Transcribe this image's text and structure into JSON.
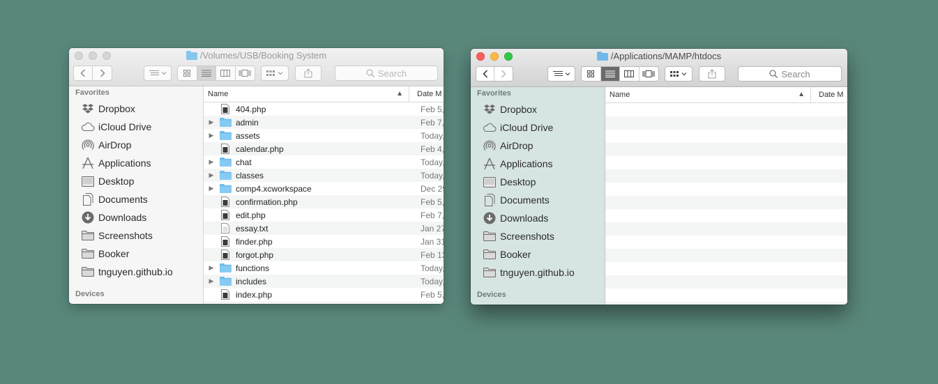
{
  "window1": {
    "title": "/Volumes/USB/Booking System",
    "search_placeholder": "Search",
    "sidebar": {
      "favorites_label": "Favorites",
      "items": [
        {
          "label": "Dropbox",
          "icon": "dropbox-icon"
        },
        {
          "label": "iCloud Drive",
          "icon": "cloud-icon"
        },
        {
          "label": "AirDrop",
          "icon": "airdrop-icon"
        },
        {
          "label": "Applications",
          "icon": "applications-icon"
        },
        {
          "label": "Desktop",
          "icon": "desktop-icon"
        },
        {
          "label": "Documents",
          "icon": "documents-icon"
        },
        {
          "label": "Downloads",
          "icon": "downloads-icon"
        },
        {
          "label": "Screenshots",
          "icon": "folder-icon"
        },
        {
          "label": "Booker",
          "icon": "folder-icon"
        },
        {
          "label": "tnguyen.github.io",
          "icon": "folder-icon"
        }
      ],
      "devices_label": "Devices"
    },
    "columns": {
      "name": "Name",
      "date": "Date M"
    },
    "files": [
      {
        "name": "404.php",
        "kind": "file",
        "date": "Feb 5,"
      },
      {
        "name": "admin",
        "kind": "folder",
        "date": "Feb 7,"
      },
      {
        "name": "assets",
        "kind": "folder",
        "date": "Today,"
      },
      {
        "name": "calendar.php",
        "kind": "file",
        "date": "Feb 4,"
      },
      {
        "name": "chat",
        "kind": "folder",
        "date": "Today,"
      },
      {
        "name": "classes",
        "kind": "folder",
        "date": "Today,"
      },
      {
        "name": "comp4.xcworkspace",
        "kind": "folder",
        "date": "Dec 29"
      },
      {
        "name": "confirmation.php",
        "kind": "file",
        "date": "Feb 5,"
      },
      {
        "name": "edit.php",
        "kind": "file",
        "date": "Feb 7,"
      },
      {
        "name": "essay.txt",
        "kind": "text",
        "date": "Jan 27"
      },
      {
        "name": "finder.php",
        "kind": "file",
        "date": "Jan 31"
      },
      {
        "name": "forgot.php",
        "kind": "file",
        "date": "Feb 13"
      },
      {
        "name": "functions",
        "kind": "folder",
        "date": "Today,"
      },
      {
        "name": "includes",
        "kind": "folder",
        "date": "Today,"
      },
      {
        "name": "index.php",
        "kind": "file",
        "date": "Feb 5,"
      }
    ]
  },
  "window2": {
    "title": "/Applications/MAMP/htdocs",
    "search_placeholder": "Search",
    "sidebar": {
      "favorites_label": "Favorites",
      "items": [
        {
          "label": "Dropbox",
          "icon": "dropbox-icon"
        },
        {
          "label": "iCloud Drive",
          "icon": "cloud-icon"
        },
        {
          "label": "AirDrop",
          "icon": "airdrop-icon"
        },
        {
          "label": "Applications",
          "icon": "applications-icon"
        },
        {
          "label": "Desktop",
          "icon": "desktop-icon"
        },
        {
          "label": "Documents",
          "icon": "documents-icon"
        },
        {
          "label": "Downloads",
          "icon": "downloads-icon"
        },
        {
          "label": "Screenshots",
          "icon": "folder-icon"
        },
        {
          "label": "Booker",
          "icon": "folder-icon"
        },
        {
          "label": "tnguyen.github.io",
          "icon": "folder-icon"
        }
      ],
      "devices_label": "Devices"
    },
    "columns": {
      "name": "Name",
      "date": "Date M"
    }
  }
}
